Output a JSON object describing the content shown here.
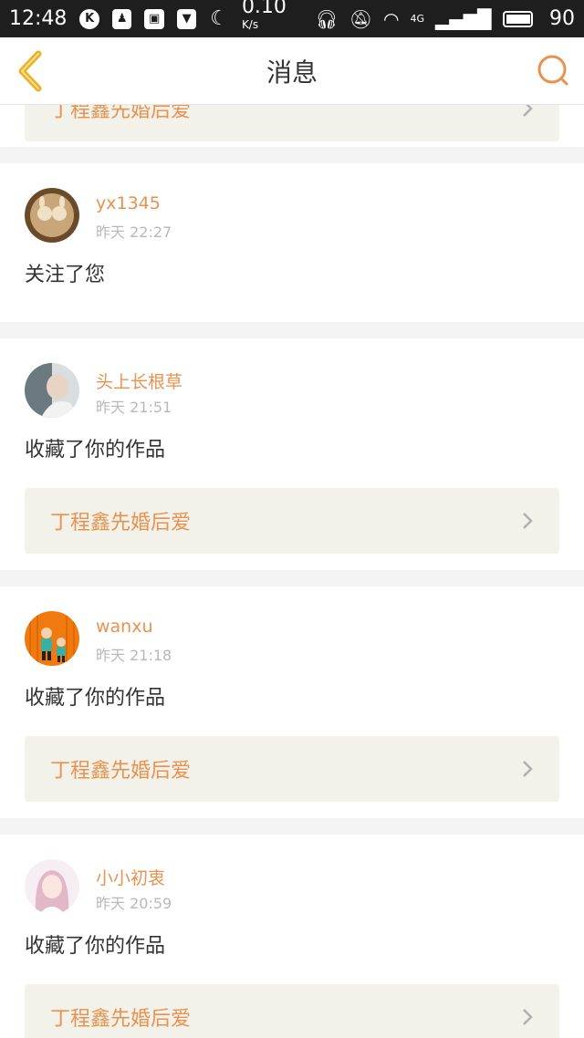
{
  "status_bar": {
    "time": "12:48",
    "speed": "0.10",
    "speed_unit": "K/s",
    "network": "4G",
    "battery": "90"
  },
  "nav": {
    "title": "消息",
    "back_icon": "back-chevron-icon",
    "search_icon": "search-icon",
    "accent": "#e8924f"
  },
  "messages": [
    {
      "username": "yx1345",
      "time": "昨天 22:27",
      "action": "关注了您"
    },
    {
      "username": "头上长根草",
      "time": "昨天 21:51",
      "action": "收藏了你的作品",
      "work_title": "丁程鑫先婚后爱"
    },
    {
      "username": "wanxu",
      "time": "昨天 21:18",
      "action": "收藏了你的作品",
      "work_title": "丁程鑫先婚后爱"
    },
    {
      "username": "小小初衷",
      "time": "昨天 20:59",
      "action": "收藏了你的作品",
      "work_title": "丁程鑫先婚后爱"
    }
  ]
}
